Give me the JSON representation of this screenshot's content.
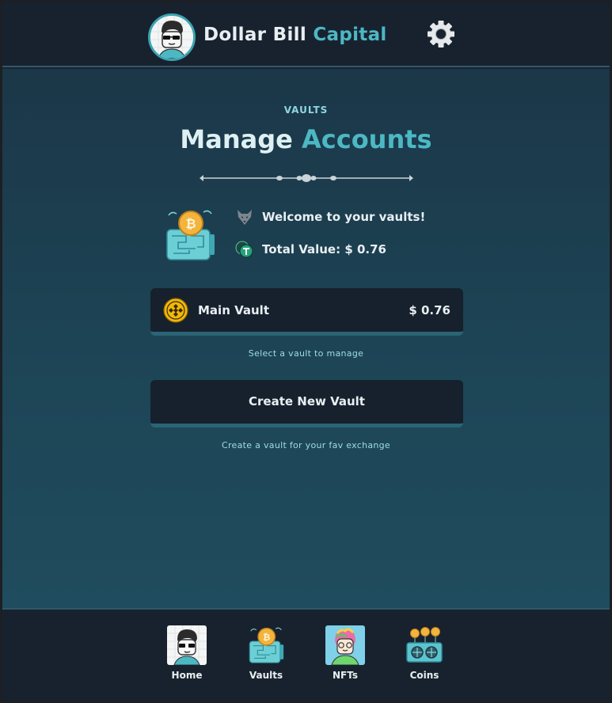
{
  "header": {
    "brand_main": "Dollar Bill",
    "brand_accent": "Capital",
    "avatar_icon": "pixel-avatar-sunglasses",
    "settings_icon": "gear-icon"
  },
  "page": {
    "eyebrow": "VAULTS",
    "title_main": "Manage",
    "title_accent": "Accounts",
    "welcome_text": "Welcome to your vaults!",
    "total_value_text": "Total Value: $ 0.76"
  },
  "vaults": [
    {
      "name": "Main Vault",
      "value": "$ 0.76",
      "icon": "binance-coin-icon"
    }
  ],
  "hints": {
    "select_vault": "Select a vault to manage",
    "create_vault": "Create a vault for your fav exchange"
  },
  "actions": {
    "create_vault_label": "Create New Vault"
  },
  "bottom_nav": {
    "items": [
      {
        "label": "Home",
        "icon": "home-avatar-icon"
      },
      {
        "label": "Vaults",
        "icon": "vault-icon"
      },
      {
        "label": "NFTs",
        "icon": "nft-icon"
      },
      {
        "label": "Coins",
        "icon": "coins-icon"
      }
    ]
  },
  "colors": {
    "accent": "#4cb8c4",
    "header_bg": "#18222e",
    "card_bg": "#16212d",
    "card_border": "#2a6475"
  }
}
